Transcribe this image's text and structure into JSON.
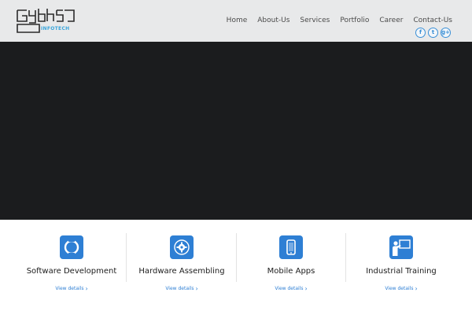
{
  "brand": {
    "logo_text": "Gybhs",
    "logo_sub": "INFOTECH",
    "colors": {
      "dark": "#2b2b2b",
      "accent": "#3aa6dc"
    }
  },
  "nav": {
    "items": [
      {
        "label": "Home"
      },
      {
        "label": "About-Us"
      },
      {
        "label": "Services"
      },
      {
        "label": "Portfolio"
      },
      {
        "label": "Career"
      },
      {
        "label": "Contact-Us"
      }
    ]
  },
  "social": {
    "items": [
      {
        "icon": "facebook-icon",
        "glyph": "f"
      },
      {
        "icon": "twitter-icon",
        "glyph": "t"
      },
      {
        "icon": "google-plus-icon",
        "glyph": "g+"
      }
    ],
    "color": "#3a8fd6"
  },
  "hero": {
    "background": "#1b1c1e"
  },
  "services": {
    "accent": "#2e7fd4",
    "items": [
      {
        "icon": "software-development-icon",
        "title": "Software Development",
        "link": "View details"
      },
      {
        "icon": "hardware-gear-icon",
        "title": "Hardware Assembling",
        "link": "View details"
      },
      {
        "icon": "mobile-phone-icon",
        "title": "Mobile Apps",
        "link": "View details"
      },
      {
        "icon": "training-presenter-icon",
        "title": "Industrial Training",
        "link": "View details"
      }
    ]
  }
}
